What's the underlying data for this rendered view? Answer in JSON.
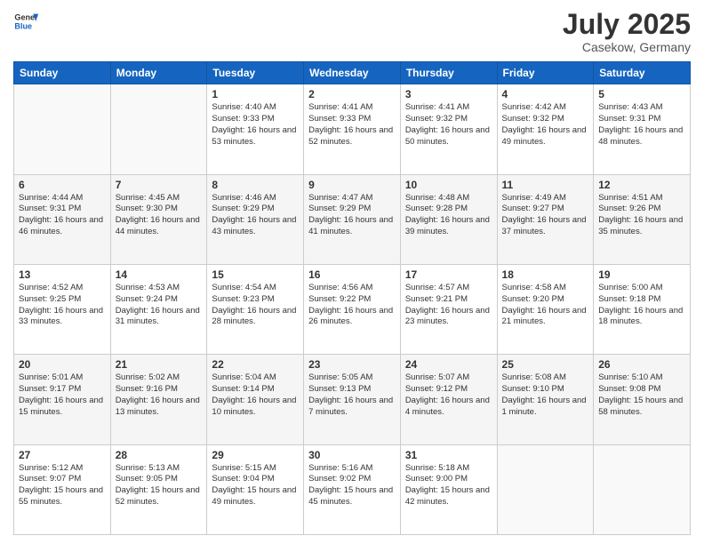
{
  "header": {
    "logo_general": "General",
    "logo_blue": "Blue",
    "month": "July 2025",
    "location": "Casekow, Germany"
  },
  "days_of_week": [
    "Sunday",
    "Monday",
    "Tuesday",
    "Wednesday",
    "Thursday",
    "Friday",
    "Saturday"
  ],
  "weeks": [
    [
      {
        "day": "",
        "content": ""
      },
      {
        "day": "",
        "content": ""
      },
      {
        "day": "1",
        "content": "Sunrise: 4:40 AM\nSunset: 9:33 PM\nDaylight: 16 hours and 53 minutes."
      },
      {
        "day": "2",
        "content": "Sunrise: 4:41 AM\nSunset: 9:33 PM\nDaylight: 16 hours and 52 minutes."
      },
      {
        "day": "3",
        "content": "Sunrise: 4:41 AM\nSunset: 9:32 PM\nDaylight: 16 hours and 50 minutes."
      },
      {
        "day": "4",
        "content": "Sunrise: 4:42 AM\nSunset: 9:32 PM\nDaylight: 16 hours and 49 minutes."
      },
      {
        "day": "5",
        "content": "Sunrise: 4:43 AM\nSunset: 9:31 PM\nDaylight: 16 hours and 48 minutes."
      }
    ],
    [
      {
        "day": "6",
        "content": "Sunrise: 4:44 AM\nSunset: 9:31 PM\nDaylight: 16 hours and 46 minutes."
      },
      {
        "day": "7",
        "content": "Sunrise: 4:45 AM\nSunset: 9:30 PM\nDaylight: 16 hours and 44 minutes."
      },
      {
        "day": "8",
        "content": "Sunrise: 4:46 AM\nSunset: 9:29 PM\nDaylight: 16 hours and 43 minutes."
      },
      {
        "day": "9",
        "content": "Sunrise: 4:47 AM\nSunset: 9:29 PM\nDaylight: 16 hours and 41 minutes."
      },
      {
        "day": "10",
        "content": "Sunrise: 4:48 AM\nSunset: 9:28 PM\nDaylight: 16 hours and 39 minutes."
      },
      {
        "day": "11",
        "content": "Sunrise: 4:49 AM\nSunset: 9:27 PM\nDaylight: 16 hours and 37 minutes."
      },
      {
        "day": "12",
        "content": "Sunrise: 4:51 AM\nSunset: 9:26 PM\nDaylight: 16 hours and 35 minutes."
      }
    ],
    [
      {
        "day": "13",
        "content": "Sunrise: 4:52 AM\nSunset: 9:25 PM\nDaylight: 16 hours and 33 minutes."
      },
      {
        "day": "14",
        "content": "Sunrise: 4:53 AM\nSunset: 9:24 PM\nDaylight: 16 hours and 31 minutes."
      },
      {
        "day": "15",
        "content": "Sunrise: 4:54 AM\nSunset: 9:23 PM\nDaylight: 16 hours and 28 minutes."
      },
      {
        "day": "16",
        "content": "Sunrise: 4:56 AM\nSunset: 9:22 PM\nDaylight: 16 hours and 26 minutes."
      },
      {
        "day": "17",
        "content": "Sunrise: 4:57 AM\nSunset: 9:21 PM\nDaylight: 16 hours and 23 minutes."
      },
      {
        "day": "18",
        "content": "Sunrise: 4:58 AM\nSunset: 9:20 PM\nDaylight: 16 hours and 21 minutes."
      },
      {
        "day": "19",
        "content": "Sunrise: 5:00 AM\nSunset: 9:18 PM\nDaylight: 16 hours and 18 minutes."
      }
    ],
    [
      {
        "day": "20",
        "content": "Sunrise: 5:01 AM\nSunset: 9:17 PM\nDaylight: 16 hours and 15 minutes."
      },
      {
        "day": "21",
        "content": "Sunrise: 5:02 AM\nSunset: 9:16 PM\nDaylight: 16 hours and 13 minutes."
      },
      {
        "day": "22",
        "content": "Sunrise: 5:04 AM\nSunset: 9:14 PM\nDaylight: 16 hours and 10 minutes."
      },
      {
        "day": "23",
        "content": "Sunrise: 5:05 AM\nSunset: 9:13 PM\nDaylight: 16 hours and 7 minutes."
      },
      {
        "day": "24",
        "content": "Sunrise: 5:07 AM\nSunset: 9:12 PM\nDaylight: 16 hours and 4 minutes."
      },
      {
        "day": "25",
        "content": "Sunrise: 5:08 AM\nSunset: 9:10 PM\nDaylight: 16 hours and 1 minute."
      },
      {
        "day": "26",
        "content": "Sunrise: 5:10 AM\nSunset: 9:08 PM\nDaylight: 15 hours and 58 minutes."
      }
    ],
    [
      {
        "day": "27",
        "content": "Sunrise: 5:12 AM\nSunset: 9:07 PM\nDaylight: 15 hours and 55 minutes."
      },
      {
        "day": "28",
        "content": "Sunrise: 5:13 AM\nSunset: 9:05 PM\nDaylight: 15 hours and 52 minutes."
      },
      {
        "day": "29",
        "content": "Sunrise: 5:15 AM\nSunset: 9:04 PM\nDaylight: 15 hours and 49 minutes."
      },
      {
        "day": "30",
        "content": "Sunrise: 5:16 AM\nSunset: 9:02 PM\nDaylight: 15 hours and 45 minutes."
      },
      {
        "day": "31",
        "content": "Sunrise: 5:18 AM\nSunset: 9:00 PM\nDaylight: 15 hours and 42 minutes."
      },
      {
        "day": "",
        "content": ""
      },
      {
        "day": "",
        "content": ""
      }
    ]
  ]
}
